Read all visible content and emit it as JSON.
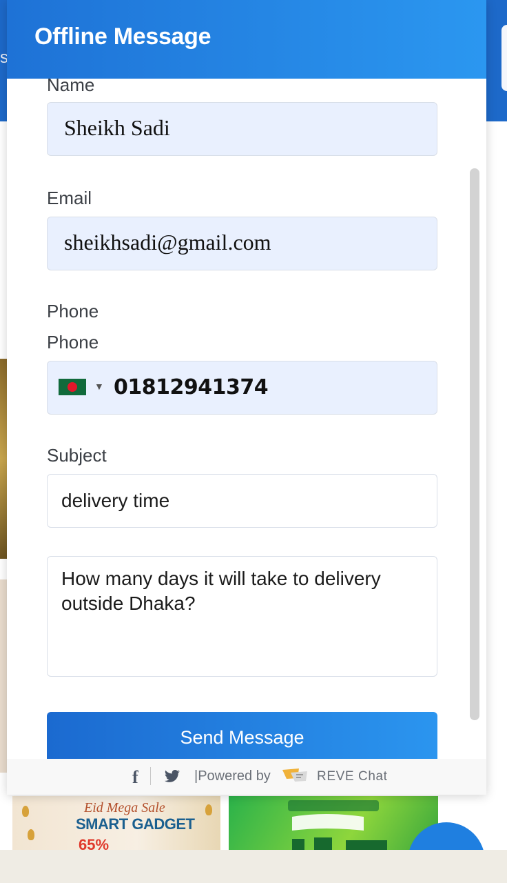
{
  "widget": {
    "title": "Offline Message",
    "scroll_position": 0.2
  },
  "form": {
    "name_label": "Name",
    "name_value": "Sheikh Sadi",
    "email_label": "Email",
    "email_value": "sheikhsadi@gmail.com",
    "phone_heading": "Phone",
    "phone_label": "Phone",
    "phone_country_flag": "bangladesh-flag",
    "phone_value": "01812941374",
    "subject_label": "Subject",
    "subject_value": "delivery time",
    "message_value": "How many days it will take to delivery outside Dhaka?",
    "send_label": "Send Message"
  },
  "footer": {
    "powered_by": "|Powered by",
    "brand": "REVE Chat"
  },
  "background": {
    "topbar_fragment": "s",
    "banner1_sub": "Eid Mega Sale",
    "banner1_main": "SMART GADGET",
    "banner1_pct": "65%"
  },
  "colors": {
    "header": "#1e72d6",
    "accent": "#2b95ef",
    "field_fill": "#e9f0fe"
  }
}
